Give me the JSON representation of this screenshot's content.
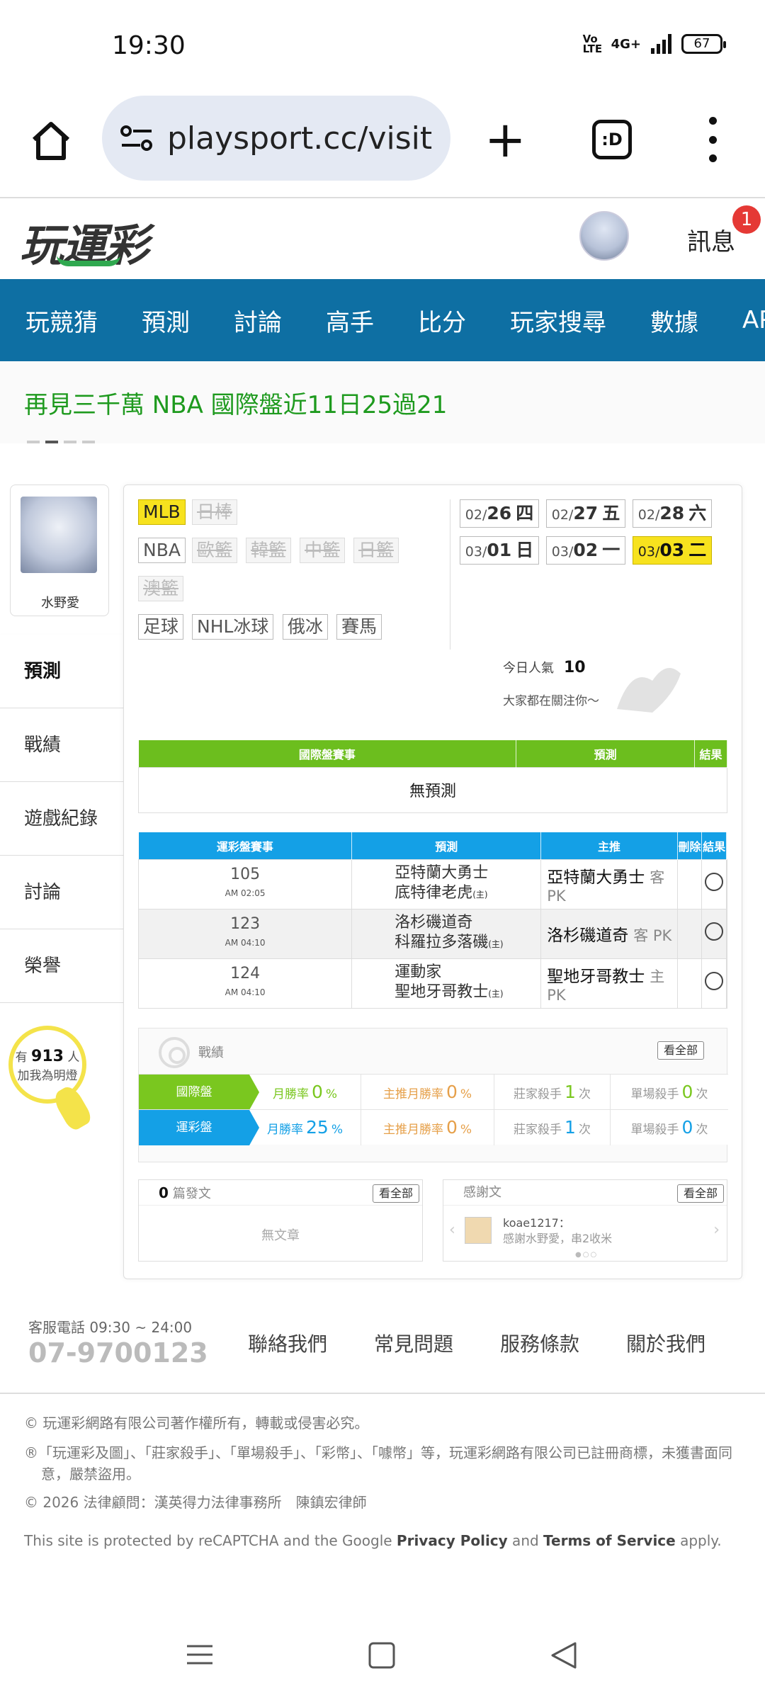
{
  "status": {
    "time": "19:30",
    "volte": "Vo LTE",
    "network": "4G+",
    "battery": "67"
  },
  "browser": {
    "url": "playsport.cc/visit",
    "tab_label": ":D"
  },
  "header": {
    "logo": "玩運彩",
    "messages_label": "訊息",
    "messages_badge": "1"
  },
  "nav": [
    "玩競猜",
    "預測",
    "討論",
    "高手",
    "比分",
    "玩家搜尋",
    "數據",
    "APP"
  ],
  "marquee": "再見三千萬 NBA 國際盤近11日25過21",
  "profile": {
    "name": "水野愛"
  },
  "side_menu": [
    "預測",
    "戰績",
    "遊戲紀錄",
    "討論",
    "榮譽"
  ],
  "fans": {
    "prefix": "有",
    "count": "913",
    "suffix": "人",
    "line2": "加我為明燈"
  },
  "leagues": {
    "row1": [
      "MLB",
      "日棒"
    ],
    "row2": [
      "NBA",
      "歐籃",
      "韓籃",
      "中籃",
      "日籃"
    ],
    "row3": [
      "澳籃"
    ],
    "row4": [
      "足球",
      "NHL冰球",
      "俄冰",
      "賽馬"
    ]
  },
  "dates": [
    {
      "md": "02/",
      "d": "26",
      "w": "四"
    },
    {
      "md": "02/",
      "d": "27",
      "w": "五"
    },
    {
      "md": "02/",
      "d": "28",
      "w": "六"
    },
    {
      "md": "03/",
      "d": "01",
      "w": "日"
    },
    {
      "md": "03/",
      "d": "02",
      "w": "一"
    },
    {
      "md": "03/",
      "d": "03",
      "w": "二"
    }
  ],
  "popularity": {
    "label": "今日人氣",
    "value": "10",
    "caption": "大家都在關注你～"
  },
  "intl_table": {
    "headers": [
      "國際盤賽事",
      "預測",
      "結果"
    ],
    "empty": "無預測"
  },
  "sports_table": {
    "headers": [
      "運彩盤賽事",
      "預測",
      "主推",
      "刪除",
      "結果"
    ],
    "rows": [
      {
        "id": "105",
        "time": "AM 02:05",
        "away": "亞特蘭大勇士",
        "home": "底特律老虎",
        "home_tag": "(主)",
        "pick": "亞特蘭大勇士",
        "pick_note": "客 PK"
      },
      {
        "id": "123",
        "time": "AM 04:10",
        "away": "洛杉磯道奇",
        "home": "科羅拉多落磯",
        "home_tag": "(主)",
        "pick": "洛杉磯道奇",
        "pick_note": "客 PK"
      },
      {
        "id": "124",
        "time": "AM 04:10",
        "away": "運動家",
        "home": "聖地牙哥教士",
        "home_tag": "(主)",
        "pick": "聖地牙哥教士",
        "pick_note": "主 PK"
      }
    ]
  },
  "record": {
    "title": "戰績",
    "see_all": "看全部",
    "rows": [
      {
        "label": "國際盤",
        "c1a": "月勝率",
        "c1v": "0",
        "c1u": "%",
        "c2a": "主推月勝率",
        "c2v": "0",
        "c2u": "%",
        "c3a": "莊家殺手",
        "c3v": "1",
        "c3u": "次",
        "c4a": "單場殺手",
        "c4v": "0",
        "c4u": "次"
      },
      {
        "label": "運彩盤",
        "c1a": "月勝率",
        "c1v": "25",
        "c1u": "%",
        "c2a": "主推月勝率",
        "c2v": "0",
        "c2u": "%",
        "c3a": "莊家殺手",
        "c3v": "1",
        "c3u": "次",
        "c4a": "單場殺手",
        "c4v": "0",
        "c4u": "次"
      }
    ]
  },
  "posts": {
    "count": "0",
    "label": "篇發文",
    "see_all": "看全部",
    "empty": "無文章"
  },
  "thanks": {
    "label": "感謝文",
    "see_all": "看全部",
    "user": "koae1217：",
    "text": "感謝水野愛，串2收米"
  },
  "footer": {
    "contact": "客服電話 09:30 ~ 24:00",
    "phone": "07-9700123",
    "links": [
      "聯絡我們",
      "常見問題",
      "服務條款",
      "關於我們"
    ],
    "copyright": "© 玩運彩網路有限公司著作權所有，轉載或侵害必究。",
    "trademark": "®「玩運彩及圖」、「莊家殺手」、「單場殺手」、「彩幣」、「噱幣」等，玩運彩網路有限公司已註冊商標，未獲書面同意，嚴禁盜用。",
    "law": "© 2026 法律顧問：漢英得力法律事務所　陳鎮宏律師",
    "recaptcha_pre": "This site is protected by reCAPTCHA and the Google ",
    "privacy": "Privacy Policy",
    "and": " and ",
    "terms": "Terms of Service",
    "apply": " apply."
  },
  "colors": {
    "nav": "#0e6fa3",
    "green": "#6cbe1e",
    "blue": "#14a0e6",
    "highlight": "#f7e21e"
  }
}
